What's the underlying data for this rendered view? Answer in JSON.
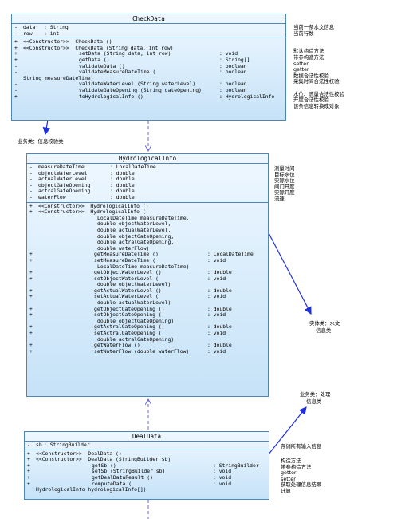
{
  "checkdata": {
    "title": "CheckData",
    "attributes": [
      {
        "vis": "-",
        "name": "data",
        "type": ": String"
      },
      {
        "vis": "-",
        "name": "row",
        "type": ": int"
      }
    ],
    "operations": [
      {
        "vis": "+",
        "name": "<<Constructor>>  CheckData ()",
        "type": ""
      },
      {
        "vis": "+",
        "name": "<<Constructor>>  CheckData (String data, int row)",
        "type": ""
      },
      {
        "vis": "+",
        "name": "setData (String data, int row)",
        "type": ": void"
      },
      {
        "vis": "+",
        "name": "getData ()",
        "type": ": String[]"
      },
      {
        "vis": "-",
        "name": "validateData ()",
        "type": ": boolean"
      },
      {
        "vis": "-",
        "name": "validateMeasureDateTime (",
        "type": ": boolean"
      },
      {
        "vis": "",
        "name": "String measureDateTime)",
        "type": ""
      },
      {
        "vis": "-",
        "name": "validateWaterLevel (String waterLevel)",
        "type": ": boolean"
      },
      {
        "vis": "-",
        "name": "validateGateOpening (String gateOpening)",
        "type": ": boolean"
      },
      {
        "vis": "+",
        "name": "toHydrologicalInfo ()",
        "type": ": HydrologicalInfo"
      }
    ],
    "notes": [
      "当前一条水文信息",
      "当前行数",
      "",
      "",
      "默认构造方法",
      "带参构造方法",
      "setter",
      "getter",
      "数据合法性校验",
      "采集时间合法性校验",
      "",
      "水位、流量合法性校验",
      "开度合法性校验",
      "该条信息转换成对象"
    ]
  },
  "label_business_check": "业务类：信息校验类",
  "hydro": {
    "title": "HydrologicalInfo",
    "attributes": [
      {
        "vis": "-",
        "name": "measureDateTime",
        "type": ": LocalDateTime"
      },
      {
        "vis": "-",
        "name": "objectWaterLevel",
        "type": ": double"
      },
      {
        "vis": "-",
        "name": "actualWaterLevel",
        "type": ": double"
      },
      {
        "vis": "-",
        "name": "objectGateOpening",
        "type": ": double"
      },
      {
        "vis": "-",
        "name": "actralGateOpening",
        "type": ": double"
      },
      {
        "vis": "-",
        "name": "waterFlow",
        "type": ": double"
      }
    ],
    "operations": [
      {
        "vis": "+",
        "name": "<<Constructor>>  HydrologicalInfo ()",
        "type": ""
      },
      {
        "vis": "+",
        "name": "<<Constructor>>  HydrologicalInfo (",
        "type": ""
      },
      {
        "vis": "",
        "name": "LocalDateTime measureDateTime,",
        "type": ""
      },
      {
        "vis": "",
        "name": "double objectWaterLevel,",
        "type": ""
      },
      {
        "vis": "",
        "name": "double actualWaterLevel,",
        "type": ""
      },
      {
        "vis": "",
        "name": "double objectGateOpening,",
        "type": ""
      },
      {
        "vis": "",
        "name": "double actralGateOpening,",
        "type": ""
      },
      {
        "vis": "",
        "name": "double waterFlow)",
        "type": ""
      },
      {
        "vis": "+",
        "name": "getMeasureDateTime ()",
        "type": ": LocalDateTime"
      },
      {
        "vis": "+",
        "name": "setMeasureDateTime (",
        "type": ": void"
      },
      {
        "vis": "",
        "name": "LocalDateTime measureDateTime)",
        "type": ""
      },
      {
        "vis": "+",
        "name": "getObjectWaterLevel ()",
        "type": ": double"
      },
      {
        "vis": "+",
        "name": "setObjectWaterLevel (",
        "type": ": void"
      },
      {
        "vis": "",
        "name": "double objectWaterLevel)",
        "type": ""
      },
      {
        "vis": "+",
        "name": "getActualWaterLevel ()",
        "type": ": double"
      },
      {
        "vis": "+",
        "name": "setActualWaterLevel (",
        "type": ": void"
      },
      {
        "vis": "",
        "name": "double actualWaterLevel)",
        "type": ""
      },
      {
        "vis": "+",
        "name": "getObjectGateOpening ()",
        "type": ": double"
      },
      {
        "vis": "+",
        "name": "setObjectGateOpening (",
        "type": ": void"
      },
      {
        "vis": "",
        "name": "double objectGateOpening)",
        "type": ""
      },
      {
        "vis": "+",
        "name": "getActralGateOpening ()",
        "type": ": double"
      },
      {
        "vis": "+",
        "name": "setActralGateOpening (",
        "type": ": void"
      },
      {
        "vis": "",
        "name": "double actralGateOpening)",
        "type": ""
      },
      {
        "vis": "+",
        "name": "getWaterFlow ()",
        "type": ": double"
      },
      {
        "vis": "+",
        "name": "setWaterFlow (double waterFlow)",
        "type": ": void"
      }
    ],
    "notes": [
      "测量时间",
      "目标水位",
      "实际水位",
      "闸门开度",
      "实际开度",
      "流速"
    ]
  },
  "label_entity": "实体类：水文\n    信息类",
  "label_business_process": "业务类：处理\n    信息类",
  "dealdata": {
    "title": "DealData",
    "attributes": [
      {
        "vis": "-",
        "name": "sb",
        "type": ": StringBuilder"
      }
    ],
    "operations": [
      {
        "vis": "+",
        "name": "<<Constructor>>  DealData ()",
        "type": ""
      },
      {
        "vis": "+",
        "name": "<<Constructor>>  DealData (StringBuilder sb)",
        "type": ""
      },
      {
        "vis": "+",
        "name": "getSb ()",
        "type": ": StringBuilder"
      },
      {
        "vis": "+",
        "name": "setSb (StringBuilder sb)",
        "type": ": void"
      },
      {
        "vis": "+",
        "name": "getDealDataResult ()",
        "type": ": void"
      },
      {
        "vis": "+",
        "name": "computeData (",
        "type": ": void"
      },
      {
        "vis": "",
        "name": "HydrologicalInfo hydrologicalInfo[])",
        "type": ""
      }
    ],
    "notes_top": "存储所有输入信息",
    "notes": [
      "构造方法",
      "带参构造方法",
      "getter",
      "setter",
      "获取处理信息结果",
      "计算"
    ]
  },
  "colors": {
    "border": "#4f86b8",
    "fill_top": "#eef7ff",
    "fill_bottom": "#c6e2f7",
    "arrow": "#1f2fe0"
  }
}
